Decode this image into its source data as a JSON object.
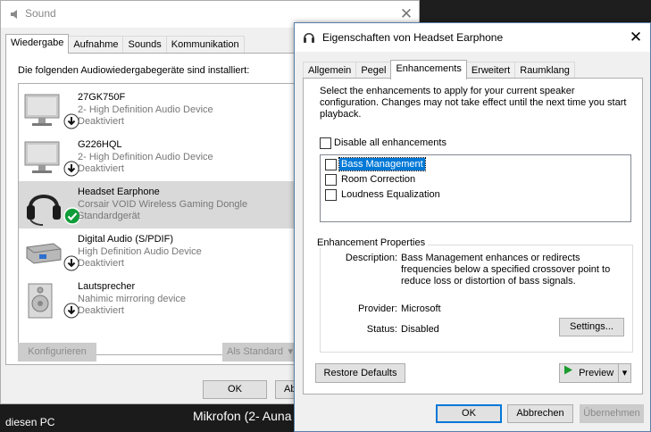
{
  "sound_window": {
    "title": "Sound",
    "close_glyph": "✕",
    "tabs": [
      {
        "label": "Wiedergabe",
        "active": true
      },
      {
        "label": "Aufnahme",
        "active": false
      },
      {
        "label": "Sounds",
        "active": false
      },
      {
        "label": "Kommunikation",
        "active": false
      }
    ],
    "instructions": "Die folgenden Audiowiedergabegeräte sind installiert:",
    "devices": [
      {
        "name": "27GK750F",
        "subtitle": "2- High Definition Audio Device",
        "status": "Deaktiviert",
        "icon": "monitor-icon",
        "badge": "down-arrow-icon",
        "selected": false
      },
      {
        "name": "G226HQL",
        "subtitle": "2- High Definition Audio Device",
        "status": "Deaktiviert",
        "icon": "monitor-icon",
        "badge": "down-arrow-icon",
        "selected": false
      },
      {
        "name": "Headset Earphone",
        "subtitle": "Corsair VOID Wireless Gaming Dongle",
        "status": "Standardgerät",
        "icon": "headset-icon",
        "badge": "checkmark-icon",
        "selected": true
      },
      {
        "name": "Digital Audio (S/PDIF)",
        "subtitle": "High Definition Audio Device",
        "status": "Deaktiviert",
        "icon": "spdif-icon",
        "badge": "down-arrow-icon",
        "selected": false
      },
      {
        "name": "Lautsprecher",
        "subtitle": "Nahimic mirroring device",
        "status": "Deaktiviert",
        "icon": "speaker-icon",
        "badge": "down-arrow-icon",
        "selected": false
      }
    ],
    "configure_label": "Konfigurieren",
    "set_default_label": "Als Standard",
    "ok_label": "OK",
    "cancel_label_partial": "Ab"
  },
  "props_window": {
    "title": "Eigenschaften von Headset Earphone",
    "close_glyph": "✕",
    "tabs": [
      {
        "label": "Allgemein",
        "active": false
      },
      {
        "label": "Pegel",
        "active": false
      },
      {
        "label": "Enhancements",
        "active": true
      },
      {
        "label": "Erweitert",
        "active": false
      },
      {
        "label": "Raumklang",
        "active": false
      }
    ],
    "description": "Select the enhancements to apply for your current speaker configuration. Changes may not take effect until the next time you start playback.",
    "disable_all_label": "Disable all enhancements",
    "enhancements": [
      {
        "label": "Bass Management",
        "selected": true
      },
      {
        "label": "Room Correction",
        "selected": false
      },
      {
        "label": "Loudness Equalization",
        "selected": false
      }
    ],
    "properties_group_title": "Enhancement Properties",
    "description_key": "Description:",
    "description_value": "Bass Management enhances or redirects frequencies below a specified crossover point to reduce loss or distortion of bass signals.",
    "provider_key": "Provider:",
    "provider_value": "Microsoft",
    "status_key": "Status:",
    "status_value": "Disabled",
    "settings_label": "Settings...",
    "restore_defaults_label": "Restore Defaults",
    "preview_label": "Preview",
    "ok_label": "OK",
    "cancel_label": "Abbrechen",
    "apply_label": "Übernehmen"
  },
  "taskbar": {
    "left_text": "diesen PC",
    "mid_text": "Mikrofon (2- Auna"
  },
  "colors": {
    "accent": "#0078d7",
    "check_green": "#0f9d39",
    "preview_green": "#1a9b2e"
  }
}
